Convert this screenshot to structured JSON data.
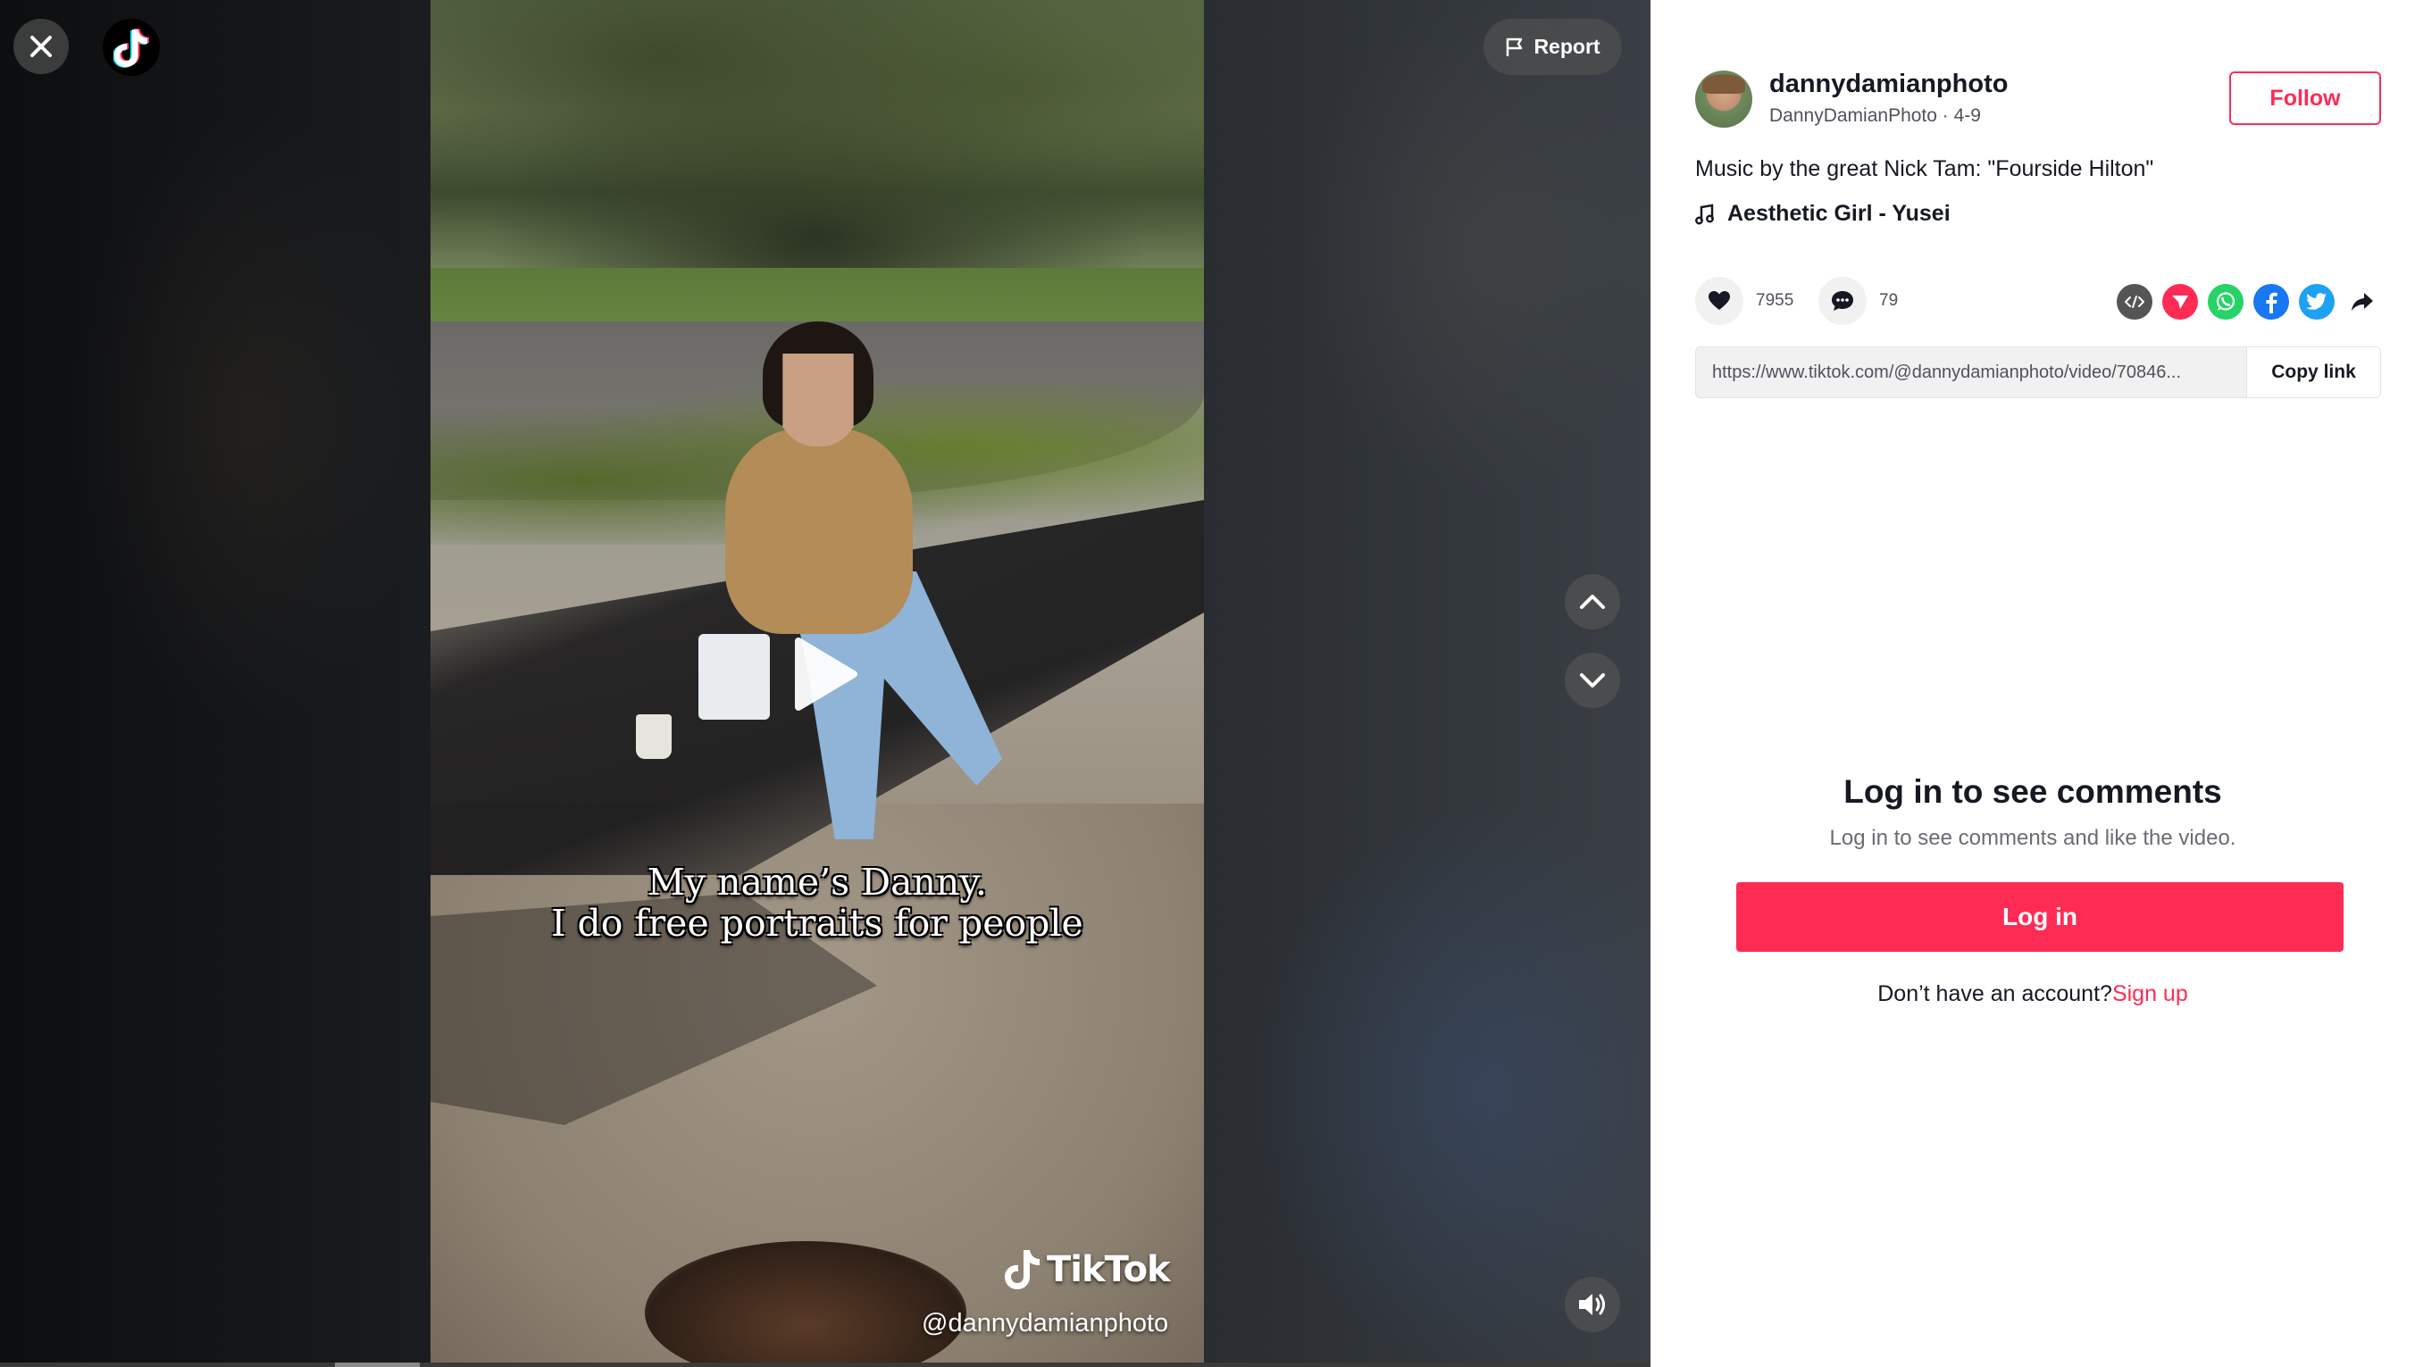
{
  "viewer": {
    "report_label": "Report",
    "caption_line1": "My name’s Danny.",
    "caption_line2": "I do free portraits for people",
    "watermark_brand": "TikTok",
    "watermark_handle": "@dannydamianphoto",
    "icons": {
      "close": "close-icon",
      "logo": "tiktok-logo-icon",
      "report": "flag-icon",
      "play": "play-icon",
      "prev": "chevron-up-icon",
      "next": "chevron-down-icon",
      "volume": "volume-icon"
    }
  },
  "author": {
    "username": "dannydamianphoto",
    "display_name": "DannyDamianPhoto",
    "date": "4-9",
    "follow_label": "Follow"
  },
  "post": {
    "description": "Music by the great Nick Tam: \"Fourside Hilton\"",
    "music": "Aesthetic Girl - Yusei",
    "likes": "7955",
    "comments": "79"
  },
  "share": {
    "icons": [
      "embed-icon",
      "send-to-friends-icon",
      "whatsapp-icon",
      "facebook-icon",
      "twitter-icon",
      "share-arrow-icon"
    ],
    "link_url": "https://www.tiktok.com/@dannydamianphoto/video/70846...",
    "copy_link_label": "Copy link"
  },
  "comments_gate": {
    "title": "Log in to see comments",
    "subtitle": "Log in to see comments and like the video.",
    "login_label": "Log in",
    "no_account_text": "Don’t have an account?",
    "signup_label": "Sign up"
  },
  "colors": {
    "brand": "#fe2c55",
    "text_primary": "#161823",
    "text_secondary": "#51525a"
  }
}
